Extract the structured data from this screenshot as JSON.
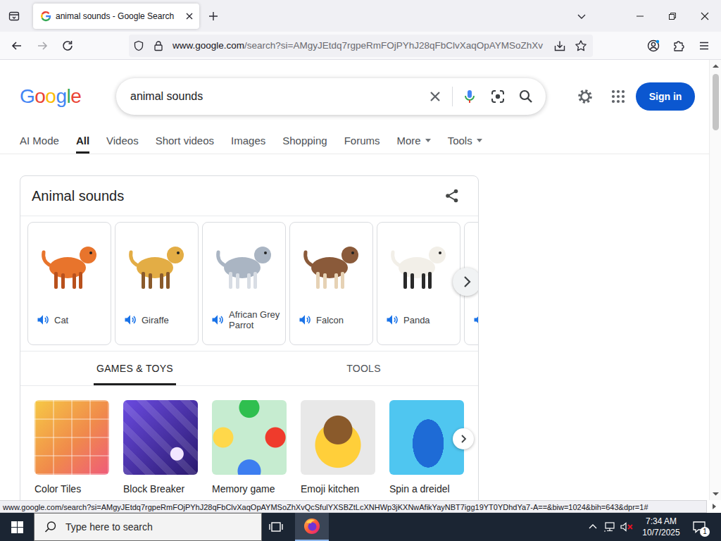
{
  "browser": {
    "tab": {
      "title": "animal sounds - Google Search",
      "selected": true
    },
    "url": {
      "domain": "www.google.com",
      "path": "/search?si=AMgyJEtdq7rgpeRmFOjPYhJ28qFbClvXaqOpAYMSoZhXv"
    },
    "back_enabled": true,
    "forward_enabled": false
  },
  "search": {
    "logo": "Google",
    "query": "animal sounds",
    "sign_in": "Sign in"
  },
  "nav_tabs": [
    {
      "label": "AI Mode",
      "selected": false,
      "dropdown": false
    },
    {
      "label": "All",
      "selected": true,
      "dropdown": false
    },
    {
      "label": "Videos",
      "selected": false,
      "dropdown": false
    },
    {
      "label": "Short videos",
      "selected": false,
      "dropdown": false
    },
    {
      "label": "Images",
      "selected": false,
      "dropdown": false
    },
    {
      "label": "Shopping",
      "selected": false,
      "dropdown": false
    },
    {
      "label": "Forums",
      "selected": false,
      "dropdown": false
    },
    {
      "label": "More",
      "selected": false,
      "dropdown": true
    },
    {
      "label": "Tools",
      "selected": false,
      "dropdown": true
    }
  ],
  "panel": {
    "title": "Animal sounds",
    "animals": [
      {
        "name": "Cat"
      },
      {
        "name": "Giraffe"
      },
      {
        "name": "African Grey Parrot"
      },
      {
        "name": "Falcon"
      },
      {
        "name": "Panda"
      }
    ],
    "subtabs": [
      {
        "label": "GAMES & TOYS",
        "selected": true
      },
      {
        "label": "TOOLS",
        "selected": false
      }
    ],
    "games": [
      {
        "name": "Color Tiles"
      },
      {
        "name": "Block Breaker"
      },
      {
        "name": "Memory game"
      },
      {
        "name": "Emoji kitchen"
      },
      {
        "name": "Spin a dreidel"
      }
    ]
  },
  "status_bar": {
    "url": "www.google.com/search?si=AMgyJEtdq7rgpeRmFOjPYhJ28qFbClvXaqOpAYMSoZhXvQcSfulYXSBZtLcXNHWp3jKXNwAfikYayNBT7igg19YT0YDhdYa7-A==&biw=1024&bih=643&dpr=1#"
  },
  "taskbar": {
    "search_placeholder": "Type here to search",
    "time": "7:34 AM",
    "date": "10/7/2025",
    "notifications": "1",
    "volume_muted": true
  }
}
